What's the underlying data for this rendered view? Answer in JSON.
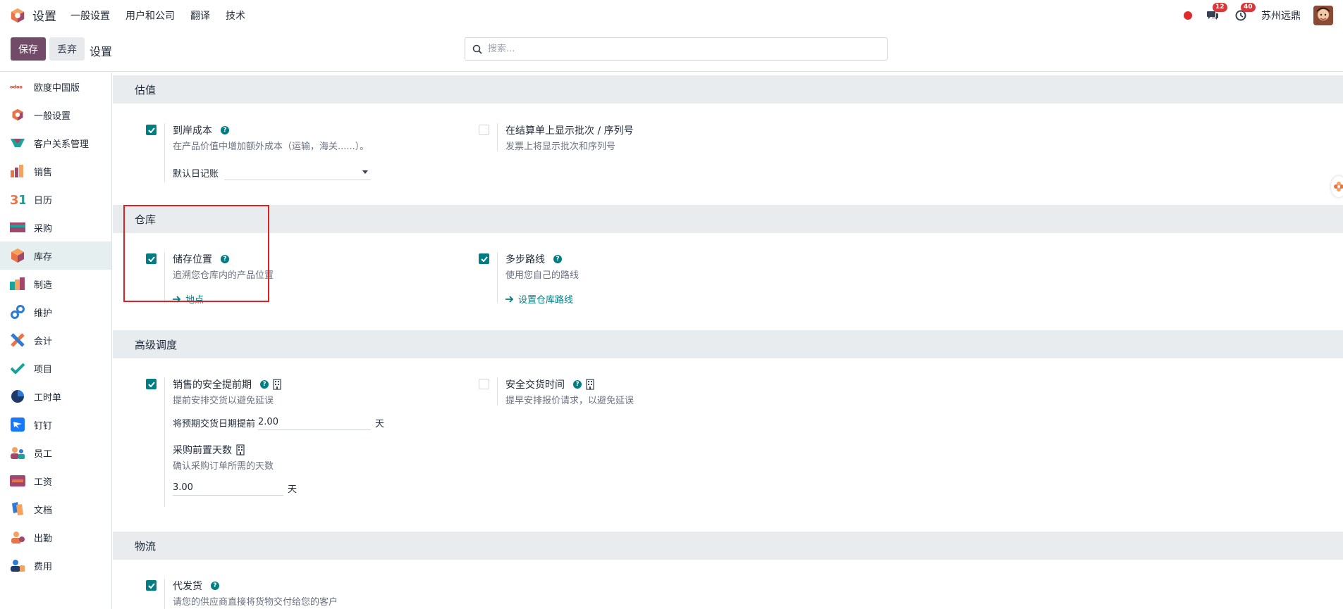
{
  "navbar": {
    "app_title": "设置",
    "menu": [
      "一般设置",
      "用户和公司",
      "翻译",
      "技术"
    ],
    "messages_count": "12",
    "activities_count": "40",
    "company": "苏州远鼎"
  },
  "control": {
    "save_label": "保存",
    "discard_label": "丢弃",
    "title": "设置",
    "search_placeholder": "搜索..."
  },
  "sidebar": {
    "items": [
      {
        "label": "欧度中国版",
        "icon": "odoo-china-logo",
        "active": false
      },
      {
        "label": "一般设置",
        "icon": "odoo-logo-icon",
        "active": false
      },
      {
        "label": "客户关系管理",
        "icon": "crm-icon",
        "active": false
      },
      {
        "label": "销售",
        "icon": "sales-chart-icon",
        "active": false
      },
      {
        "label": "日历",
        "icon": "calendar-31-icon",
        "active": false
      },
      {
        "label": "采购",
        "icon": "purchase-card-icon",
        "active": false
      },
      {
        "label": "库存",
        "icon": "inventory-box-icon",
        "active": true
      },
      {
        "label": "制造",
        "icon": "manufacturing-icon",
        "active": false
      },
      {
        "label": "维护",
        "icon": "maintenance-icon",
        "active": false
      },
      {
        "label": "会计",
        "icon": "accounting-icon",
        "active": false
      },
      {
        "label": "项目",
        "icon": "project-check-icon",
        "active": false
      },
      {
        "label": "工时单",
        "icon": "timesheet-clock-icon",
        "active": false
      },
      {
        "label": "钉钉",
        "icon": "dingtalk-icon",
        "active": false
      },
      {
        "label": "员工",
        "icon": "employees-icon",
        "active": false
      },
      {
        "label": "工资",
        "icon": "payroll-icon",
        "active": false
      },
      {
        "label": "文档",
        "icon": "documents-icon",
        "active": false
      },
      {
        "label": "出勤",
        "icon": "attendance-icon",
        "active": false
      },
      {
        "label": "费用",
        "icon": "expenses-icon",
        "active": false
      }
    ]
  },
  "sections": {
    "valuation": {
      "title": "估值",
      "landed_cost": {
        "title": "到岸成本",
        "desc": "在产品价值中增加额外成本（运输，海关......）。",
        "checked": true,
        "journal_label": "默认日记账",
        "journal_value": ""
      },
      "lots_invoice": {
        "title": "在结算单上显示批次 / 序列号",
        "desc": "发票上将显示批次和序列号",
        "checked": false
      }
    },
    "warehouse": {
      "title": "仓库",
      "storage": {
        "title": "储存位置",
        "desc": "追溯您仓库内的产品位置",
        "checked": true,
        "link": "地点"
      },
      "routes": {
        "title": "多步路线",
        "desc": "使用您自己的路线",
        "checked": true,
        "link": "设置仓库路线"
      }
    },
    "scheduling": {
      "title": "高级调度",
      "sales_lead": {
        "title": "销售的安全提前期",
        "desc": "提前安排交货以避免延误",
        "checked": true,
        "field_label": "将预期交货日期提前",
        "field_value": "2.00",
        "unit": "天"
      },
      "purchase_lead": {
        "title": "安全交货时间",
        "desc": "提早安排报价请求，以避免延误",
        "checked": false
      },
      "po_lead": {
        "title": "采购前置天数",
        "desc": "确认采购订单所需的天数",
        "field_value": "3.00",
        "unit": "天"
      }
    },
    "logistics": {
      "title": "物流",
      "dropship": {
        "title": "代发货",
        "desc": "请您的供应商直接将货物交付给您的客户",
        "checked": true
      }
    }
  },
  "colors": {
    "primary": "#714b67",
    "accent": "#017e84",
    "highlight": "#e02020"
  }
}
